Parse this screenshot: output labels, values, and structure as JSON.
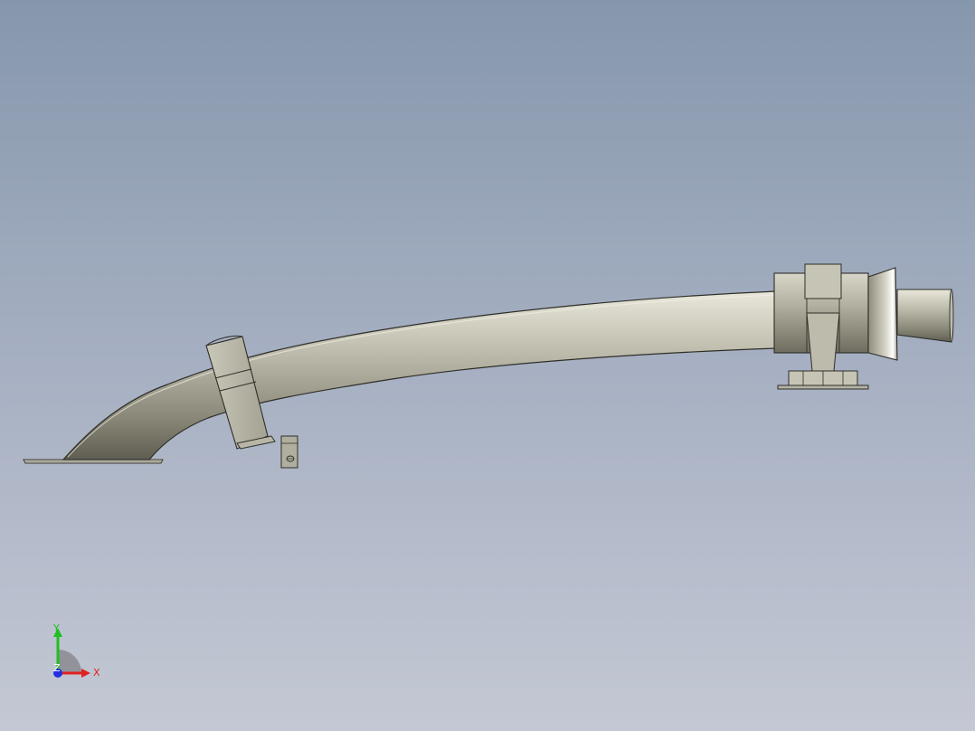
{
  "axes": {
    "x_label": "X",
    "y_label": "Y",
    "z_label": "Z",
    "x_color": "#e02020",
    "y_color": "#20c020",
    "z_color": "#2030e0"
  },
  "model": {
    "parts": [
      "pipe-elbow",
      "pipe-body",
      "clamp-left",
      "bracket-left",
      "coupling-right",
      "flange-left",
      "flange-right",
      "pipe-end"
    ],
    "metal_color": "#c8c6b6"
  }
}
